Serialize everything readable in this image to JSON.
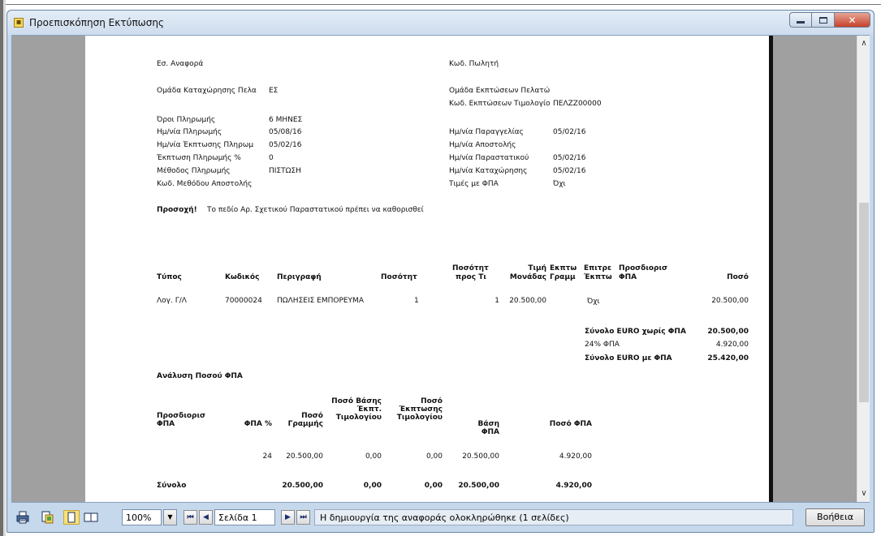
{
  "window": {
    "title": "Προεπισκόπηση Εκτύπωσης",
    "title_icon": "report-icon",
    "buttons": {
      "minimize": "minimize-icon",
      "maximize": "maximize-icon",
      "close": "✕"
    }
  },
  "report": {
    "fields_left": [
      {
        "label": "Εσ. Αναφορά",
        "value": ""
      },
      {
        "label": "Ομάδα Καταχώρησης Πελα",
        "value": "ΕΣ"
      },
      {
        "label": "Όροι Πληρωμής",
        "value": "6 ΜΗΝΕΣ"
      },
      {
        "label": "Ημ/νία Πληρωμής",
        "value": "05/08/16"
      },
      {
        "label": "Ημ/νία Έκπτωσης Πληρωμ",
        "value": "05/02/16"
      },
      {
        "label": "Έκπτωση Πληρωμής %",
        "value": "0"
      },
      {
        "label": "Μέθοδος Πληρωμής",
        "value": "ΠΙΣΤΩΣΗ"
      },
      {
        "label": "Κωδ. Μεθόδου Αποστολής",
        "value": ""
      }
    ],
    "fields_right": [
      {
        "label": "Κωδ. Πωλητή",
        "value": ""
      },
      {
        "label": "Ομάδα Εκπτώσεων Πελατώ",
        "value": ""
      },
      {
        "label": "Κωδ. Εκπτώσεων Τιμολογίο",
        "value": "ΠΕΛΖΖ00000"
      },
      {
        "label": "Ημ/νία Παραγγελίας",
        "value": "05/02/16"
      },
      {
        "label": "Ημ/νία Αποστολής",
        "value": ""
      },
      {
        "label": "Ημ/νία Παραστατικού",
        "value": "05/02/16"
      },
      {
        "label": "Ημ/νία Καταχώρησης",
        "value": "05/02/16"
      },
      {
        "label": "Τιμές με ΦΠΑ",
        "value": "Όχι"
      }
    ],
    "warning": {
      "label": "Προσοχή!",
      "text": "Το πεδίο Αρ. Σχετικού Παραστατικού πρέπει να καθορισθεί"
    },
    "lines_table": {
      "headers": {
        "type": "Τύπος",
        "code": "Κωδικός",
        "description": "Περιγραφή",
        "quantity": "Ποσότητ",
        "qty_to_1": "Ποσότητ",
        "qty_to_2": "προς Τι",
        "unit_price_1": "Τιμή",
        "unit_price_2": "Μονάδας",
        "line_disc_1": "Εκπτω",
        "line_disc_2": "Γραμμ",
        "allow_disc_1": "Επιτρε",
        "allow_disc_2": "Έκπτω",
        "vat_spec_1": "Προσδιορισ",
        "vat_spec_2": "ΦΠΑ",
        "amount": "Ποσό"
      },
      "rows": [
        {
          "type": "Λογ. Γ/Λ",
          "code": "70000024",
          "description": "ΠΩΛΗΣΕΙΣ ΕΜΠΟΡΕΥΜΑ",
          "quantity": "1",
          "qty_to": "1",
          "unit_price": "20.500,00",
          "line_disc": "",
          "allow_disc": "Όχι",
          "vat_spec": "",
          "amount": "20.500,00"
        }
      ]
    },
    "totals": [
      {
        "label": "Σύνολο EURO χωρίς ΦΠΑ",
        "value": "20.500,00",
        "bold": true
      },
      {
        "label": "24% ΦΠΑ",
        "value": "4.920,00",
        "bold": false
      },
      {
        "label": "Σύνολο EURO με ΦΠΑ",
        "value": "25.420,00",
        "bold": true
      }
    ],
    "vat_analysis": {
      "title": "Ανάλυση Ποσού ΦΠΑ",
      "headers": {
        "vat_spec_1": "Προσδιορισ",
        "vat_spec_2": "ΦΠΑ",
        "vat_pct": "ΦΠΑ %",
        "line_amount_1": "Ποσό",
        "line_amount_2": "Γραμμής",
        "inv_disc_base_1": "Ποσό Βάσης",
        "inv_disc_base_2": "Έκπτ.",
        "inv_disc_base_3": "Τιμολογίου",
        "inv_disc_amt_1": "Ποσό",
        "inv_disc_amt_2": "Έκπτωσης",
        "inv_disc_amt_3": "Τιμολογίου",
        "vat_base": "Βάση ΦΠΑ",
        "vat_amount": "Ποσό ΦΠΑ"
      },
      "rows": [
        {
          "vat_spec": "",
          "vat_pct": "24",
          "line_amount": "20.500,00",
          "inv_disc_base": "0,00",
          "inv_disc_amt": "0,00",
          "vat_base": "20.500,00",
          "vat_amount": "4.920,00"
        }
      ],
      "total": {
        "label": "Σύνολο",
        "line_amount": "20.500,00",
        "inv_disc_base": "0,00",
        "inv_disc_amt": "0,00",
        "vat_base": "20.500,00",
        "vat_amount": "4.920,00"
      }
    }
  },
  "toolbar": {
    "icons": [
      "print-icon",
      "page-setup-icon",
      "single-page-icon",
      "two-pages-icon"
    ],
    "zoom": "100%",
    "first_page": "⏮",
    "prev_page": "◀",
    "page_label": "Σελίδα 1",
    "next_page": "▶",
    "last_page": "⏭",
    "status": "Η δημιουργία της αναφοράς ολοκληρώθηκε (1 σελίδες)",
    "help_label": "Βοήθεια"
  },
  "scrollbar": {
    "up": "∧",
    "down": "∨"
  }
}
